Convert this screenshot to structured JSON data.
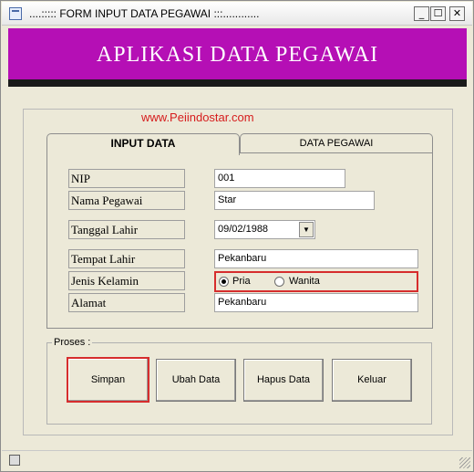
{
  "window": {
    "title": "....::::: FORM INPUT DATA PEGAWAI :::............",
    "controls": {
      "minimize": "_",
      "maximize": "☐",
      "close": "✕"
    }
  },
  "banner": {
    "title": "APLIKASI DATA PEGAWAI",
    "color": "#b50fb5"
  },
  "watermark": "www.Peiindostar.com",
  "tabs": {
    "input": "INPUT DATA",
    "data": "DATA PEGAWAI"
  },
  "form": {
    "nip": {
      "label": "NIP",
      "value": "001"
    },
    "nama": {
      "label": "Nama Pegawai",
      "value": "Star"
    },
    "tanggal": {
      "label": "Tanggal Lahir",
      "value": "09/02/1988"
    },
    "tempat": {
      "label": "Tempat Lahir",
      "value": "Pekanbaru"
    },
    "jenis": {
      "label": "Jenis Kelamin",
      "options": {
        "pria": "Pria",
        "wanita": "Wanita"
      },
      "selected": "Pria"
    },
    "alamat": {
      "label": "Alamat",
      "value": "Pekanbaru"
    }
  },
  "proses": {
    "label": "Proses :",
    "simpan": "Simpan",
    "ubah": "Ubah Data",
    "hapus": "Hapus Data",
    "keluar": "Keluar"
  },
  "colors": {
    "highlight": "#d62d2d",
    "watermark": "#d61d1d"
  }
}
